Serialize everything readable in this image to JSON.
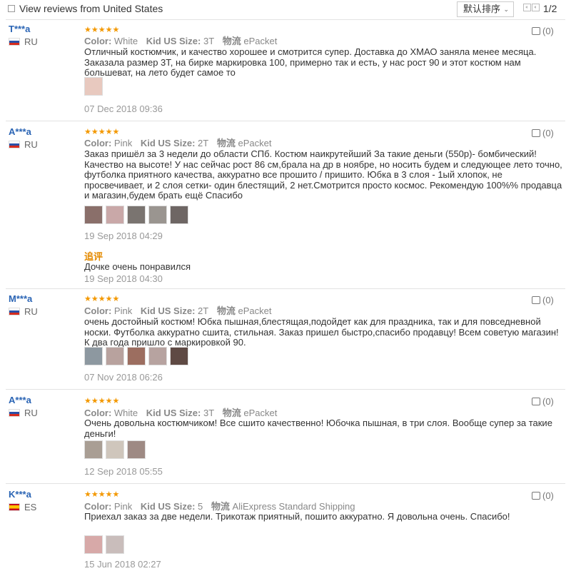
{
  "header": {
    "filter_label": "View reviews from United States",
    "sort_label": "默认排序",
    "pager_text": "1/2"
  },
  "colors": {
    "star": "#f39800",
    "username": "#2a64b4",
    "follow_up": "#e48a00"
  },
  "reviews": [
    {
      "user": "T***a",
      "country": "RU",
      "stars": "★★★★★",
      "color_label": "Color:",
      "color_value": "White",
      "size_label": "Kid US Size:",
      "size_value": "3T",
      "shipping_label": "物流",
      "shipping_value": "ePacket",
      "text": "Отличный костюмчик, и качество хорошее и смотрится супер. Доставка до ХМАО заняла менее месяца. Заказала размер 3Т, на бирке маркировка 100, примерно так и есть, у нас рост 90 и этот костюм нам большеват, на лето будет самое то",
      "thumb_colors": [
        "#e8c9bf"
      ],
      "date": "07 Dec 2018 09:36",
      "likes": "(0)"
    },
    {
      "user": "A***a",
      "country": "RU",
      "stars": "★★★★★",
      "color_label": "Color:",
      "color_value": "Pink",
      "size_label": "Kid US Size:",
      "size_value": "2T",
      "shipping_label": "物流",
      "shipping_value": "ePacket",
      "text": "Заказ пришёл за 3 недели до области СПб. Костюм наикрутейший За такие деньги (550р)- бомбический! Качество на высоте! У нас сейчас рост 86 см,брала на др в ноябре, но носить будем и следующее лето точно, футболка приятного качества, аккуратно все прошито / пришито. Юбка в 3 слоя - 1ый хлопок, не просвечивает, и 2 слоя сетки- один блестящий, 2 нет.Смотрится просто космос. Рекомендую 100%% продавца и магазин,будем брать ещё Спасибо",
      "thumb_colors": [
        "#8a6f6a",
        "#c9a8a8",
        "#7a7470",
        "#9a9590",
        "#6e6664"
      ],
      "date": "19 Sep 2018 04:29",
      "likes": "(0)",
      "followup_label": "追评",
      "followup_text": "Дочке очень понравился",
      "followup_date": "19 Sep 2018 04:30"
    },
    {
      "user": "M***a",
      "country": "RU",
      "stars": "★★★★★",
      "color_label": "Color:",
      "color_value": "Pink",
      "size_label": "Kid US Size:",
      "size_value": "2T",
      "shipping_label": "物流",
      "shipping_value": "ePacket",
      "text": "очень достойный костюм! Юбка пышная,блестящая,подойдет как для праздника, так и для повседневной носки. Футболка аккуратно сшита, стильная. Заказ пришел быстро,спасибо продавцу! Всем советую магазин! К два года пришло с маркировкой 90.",
      "thumb_colors": [
        "#8d98a0",
        "#b8a29e",
        "#9c6e60",
        "#b7a3a0",
        "#5f4a44"
      ],
      "date": "07 Nov 2018 06:26",
      "likes": "(0)"
    },
    {
      "user": "A***a",
      "country": "RU",
      "stars": "★★★★★",
      "color_label": "Color:",
      "color_value": "White",
      "size_label": "Kid US Size:",
      "size_value": "3T",
      "shipping_label": "物流",
      "shipping_value": "ePacket",
      "text": "Очень довольна костюмчиком! Все сшито качественно! Юбочка пышная, в три слоя. Вообще супер за такие деньги!",
      "thumb_colors": [
        "#a99e94",
        "#cfc6bc",
        "#9e8a84"
      ],
      "date": "12 Sep 2018 05:55",
      "likes": "(0)"
    },
    {
      "user": "K***a",
      "country": "ES",
      "stars": "★★★★★",
      "color_label": "Color:",
      "color_value": "Pink",
      "size_label": "Kid US Size:",
      "size_value": "5",
      "shipping_label": "物流",
      "shipping_value": "AliExpress Standard Shipping",
      "text": "Приехал заказ за две недели. Трикотаж приятный, пошито аккуратно. Я довольна очень. Спасибо!",
      "thumb_colors": [
        "#d7a9a8",
        "#c9bdbb"
      ],
      "date": "15 Jun 2018 02:27",
      "likes": "(0)"
    }
  ]
}
